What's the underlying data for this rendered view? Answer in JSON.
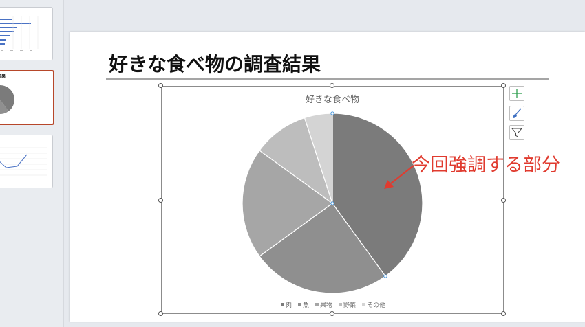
{
  "slide": {
    "title": "好きな食べ物の調査結果"
  },
  "thumbnails": [
    {
      "label": "",
      "selected": false,
      "kind": "bar"
    },
    {
      "label": "結果",
      "selected": true,
      "kind": "pie"
    },
    {
      "label": "",
      "selected": false,
      "kind": "line"
    }
  ],
  "annotation": {
    "text": "今回強調する部分",
    "color": "#e03b2f"
  },
  "chart_tools": [
    {
      "name": "chart-elements-button",
      "icon": "plus-icon"
    },
    {
      "name": "chart-styles-button",
      "icon": "brush-icon"
    },
    {
      "name": "chart-filters-button",
      "icon": "filter-icon"
    }
  ],
  "chart_data": {
    "type": "pie",
    "title": "好きな食べ物",
    "categories": [
      "肉",
      "魚",
      "果物",
      "野菜",
      "その他"
    ],
    "values": [
      40,
      25,
      20,
      10,
      5
    ],
    "colors": [
      "#7b7b7b",
      "#8f8f8f",
      "#a6a6a6",
      "#bdbdbd",
      "#d4d4d4"
    ],
    "legend_position": "bottom",
    "highlighted_slice": "肉"
  }
}
